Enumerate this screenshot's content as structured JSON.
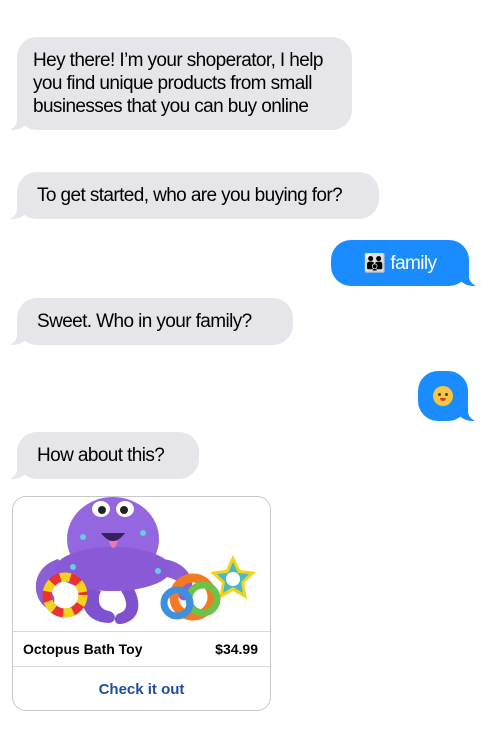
{
  "messages": [
    {
      "side": "bot",
      "text": "Hey there! I’m your shoperator, I help you find unique products from small businesses that you can buy online"
    },
    {
      "side": "bot",
      "text": "To get started, who are you buying for?"
    },
    {
      "side": "user",
      "emoji": "family-emoji",
      "text": "family"
    },
    {
      "side": "bot",
      "text": "Sweet.  Who in your family?"
    },
    {
      "side": "user",
      "emoji": "baby-emoji",
      "text": ""
    },
    {
      "side": "bot",
      "text": "How about this?"
    }
  ],
  "product_card": {
    "image": "octopus-bath-toy",
    "name": "Octopus Bath Toy",
    "price": "$34.99",
    "action_label": "Check it out"
  },
  "colors": {
    "incoming_bubble": "#e5e5ea",
    "outgoing_bubble": "#1a8cff",
    "link_text": "#1e4f9e"
  }
}
